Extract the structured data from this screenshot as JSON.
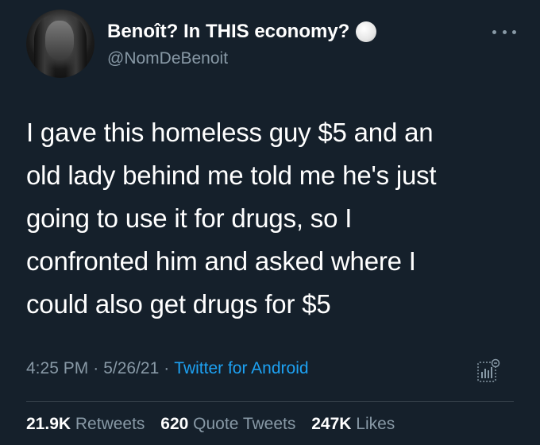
{
  "author": {
    "display_name": "Benoît? In THIS economy?",
    "handle": "@NomDeBenoit"
  },
  "tweet": {
    "text": "I gave this homeless guy $5 and an\nold lady behind me told me he's just\ngoing to use it for drugs, so I\nconfronted him and asked where I\ncould also get drugs for $5",
    "time": "4:25 PM",
    "date": "5/26/21",
    "separator": "·",
    "source": "Twitter for Android"
  },
  "stats": {
    "retweets_count": "21.9K",
    "retweets_label": "Retweets",
    "quotes_count": "620",
    "quotes_label": "Quote Tweets",
    "likes_count": "247K",
    "likes_label": "Likes"
  },
  "colors": {
    "background": "#15202b",
    "accent": "#1da1f2",
    "secondary_text": "#8899a6"
  },
  "icons": [
    "avatar",
    "verified-like-badge-icon",
    "more-options-icon",
    "tweet-analytics-icon"
  ]
}
